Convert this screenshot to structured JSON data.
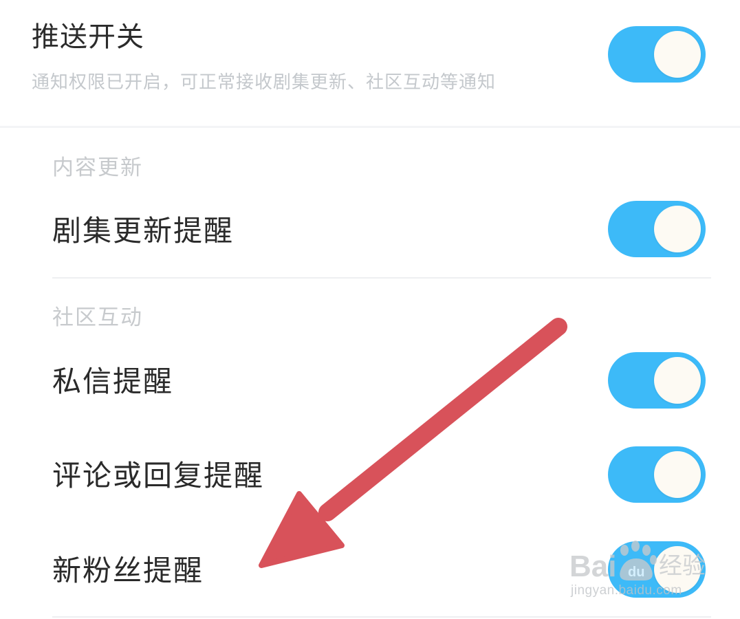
{
  "master": {
    "title": "推送开关",
    "subtitle": "通知权限已开启，可正常接收剧集更新、社区互动等通知",
    "enabled": true
  },
  "sections": [
    {
      "header": "内容更新",
      "items": [
        {
          "label": "剧集更新提醒",
          "enabled": true
        }
      ]
    },
    {
      "header": "社区互动",
      "items": [
        {
          "label": "私信提醒",
          "enabled": true
        },
        {
          "label": "评论或回复提醒",
          "enabled": true
        },
        {
          "label": "新粉丝提醒",
          "enabled": true
        }
      ]
    }
  ],
  "colors": {
    "toggle_on": "#3dbaf8",
    "knob": "#fdfaf3",
    "annotation_arrow": "#d8525a"
  },
  "annotation": {
    "type": "arrow",
    "points_to": "新粉丝提醒"
  },
  "watermark": {
    "logo_text": "Baidu经验",
    "url": "jingyan.baidu.com"
  }
}
